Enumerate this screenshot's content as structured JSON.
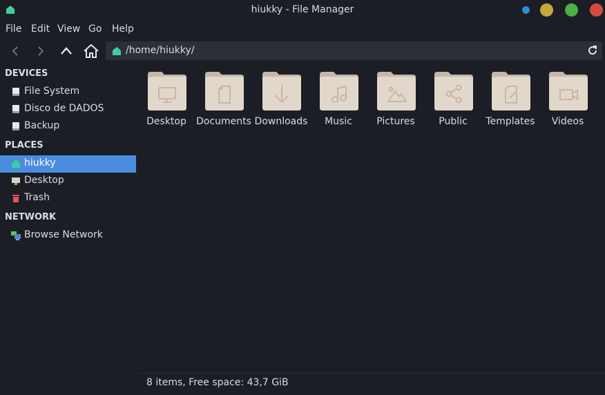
{
  "window": {
    "title": "hiukky - File Manager",
    "accent": "#4a8ce0",
    "home_icon_color": "#3ccf9a"
  },
  "menu": [
    "File",
    "Edit",
    "View",
    "Go",
    "Help"
  ],
  "toolbar": {
    "back_icon": "chevron-left-icon",
    "forward_icon": "chevron-right-icon",
    "up_icon": "chevron-up-icon",
    "home_icon": "home-icon",
    "address": "/home/hiukky/",
    "refresh_icon": "refresh-icon"
  },
  "sidebar": {
    "devices_header": "DEVICES",
    "devices": [
      {
        "label": "File System",
        "icon": "drive-icon"
      },
      {
        "label": "Disco de DADOS",
        "icon": "drive-icon"
      },
      {
        "label": "Backup",
        "icon": "drive-icon"
      }
    ],
    "places_header": "PLACES",
    "places": [
      {
        "label": "hiukky",
        "icon": "home-icon",
        "selected": true
      },
      {
        "label": "Desktop",
        "icon": "desktop-icon"
      },
      {
        "label": "Trash",
        "icon": "trash-icon"
      }
    ],
    "network_header": "NETWORK",
    "network": [
      {
        "label": "Browse Network",
        "icon": "network-icon"
      }
    ]
  },
  "folders": [
    {
      "label": "Desktop",
      "icon": "monitor-icon"
    },
    {
      "label": "Documents",
      "icon": "document-icon"
    },
    {
      "label": "Downloads",
      "icon": "download-icon"
    },
    {
      "label": "Music",
      "icon": "music-icon"
    },
    {
      "label": "Pictures",
      "icon": "picture-icon"
    },
    {
      "label": "Public",
      "icon": "share-icon"
    },
    {
      "label": "Templates",
      "icon": "template-icon"
    },
    {
      "label": "Videos",
      "icon": "video-icon"
    }
  ],
  "status": {
    "text": "8 items, Free space: 43,7 GiB"
  }
}
